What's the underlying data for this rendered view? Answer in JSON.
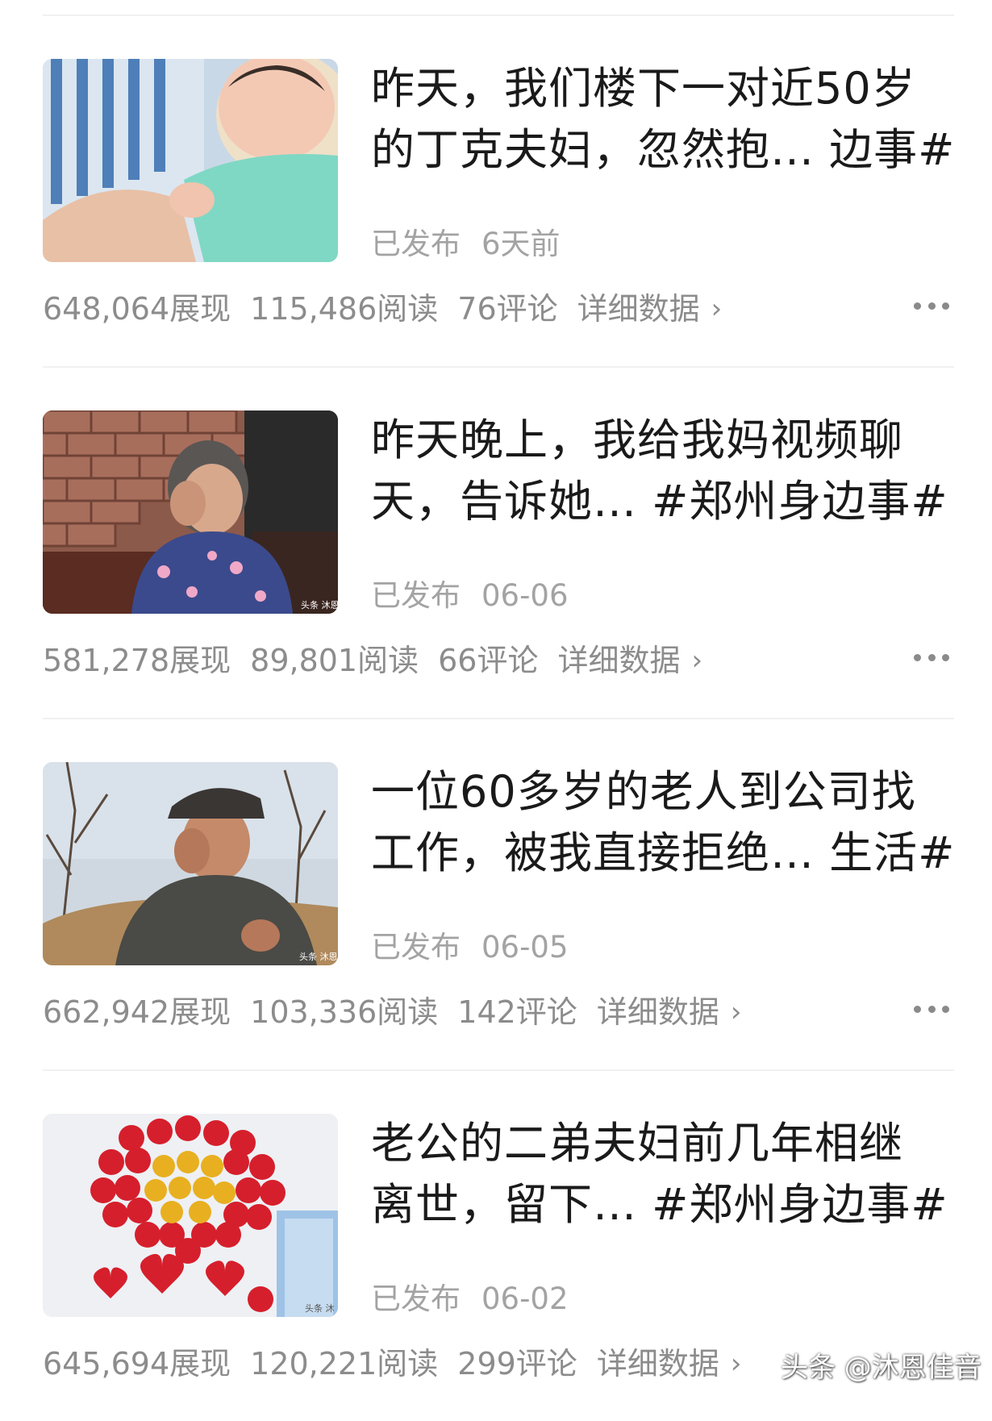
{
  "articles": [
    {
      "title_line1": "昨天，我们楼下一对近50岁",
      "title_line2": "的丁克夫妇，忽然抱… 边事#",
      "status": "已发布",
      "time": "6天前",
      "impressions": "648,064展现",
      "reads": "115,486阅读",
      "comments": "76评论",
      "detail_label": "详细数据",
      "thumbnail": "newborn-baby-photo"
    },
    {
      "title_line1": "昨天晚上，我给我妈视频聊",
      "title_line2": "天，告诉她… #郑州身边事#",
      "status": "已发布",
      "time": "06-06",
      "impressions": "581,278展现",
      "reads": "89,801阅读",
      "comments": "66评论",
      "detail_label": "详细数据",
      "thumbnail": "elderly-woman-crying-photo",
      "thumb_caption": "头条 沐恩"
    },
    {
      "title_line1": "一位60多岁的老人到公司找",
      "title_line2": "工作，被我直接拒绝… 生活#",
      "status": "已发布",
      "time": "06-05",
      "impressions": "662,942展现",
      "reads": "103,336阅读",
      "comments": "142评论",
      "detail_label": "详细数据",
      "thumbnail": "elderly-man-crying-photo",
      "thumb_caption": "头条 沐恩"
    },
    {
      "title_line1": "老公的二弟夫妇前几年相继",
      "title_line2": "离世，留下… #郑州身边事#",
      "status": "已发布",
      "time": "06-02",
      "impressions": "645,694展现",
      "reads": "120,221阅读",
      "comments": "299评论",
      "detail_label": "详细数据",
      "thumbnail": "red-balloon-decoration-photo",
      "thumb_caption": "头条 沐"
    }
  ],
  "icons": {
    "detail": "chevron-right-icon",
    "more": "more-dots-icon"
  },
  "watermark": "头条 @沐恩佳音",
  "colors": {
    "title": "#1a1a1a",
    "meta": "#a3a3a3",
    "stats": "#8c8c8c",
    "divider": "#f1f1f1"
  }
}
